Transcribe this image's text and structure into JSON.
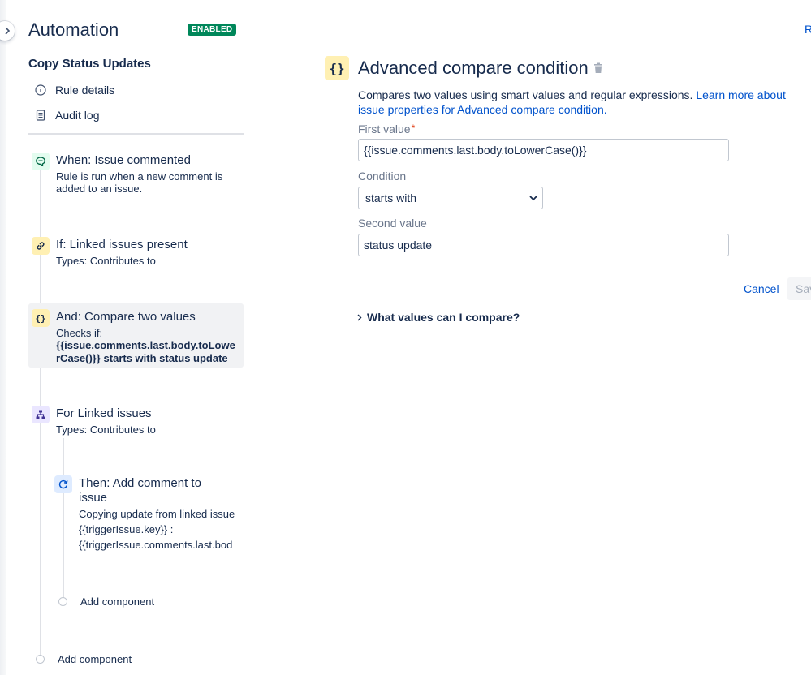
{
  "header": {
    "title": "Automation",
    "status_badge": "ENABLED",
    "top_right_link": "R"
  },
  "rule": {
    "name": "Copy Status Updates",
    "nav": [
      {
        "label": "Rule details",
        "icon": "info-icon"
      },
      {
        "label": "Audit log",
        "icon": "document-icon"
      }
    ]
  },
  "steps": {
    "trigger": {
      "title": "When: Issue commented",
      "desc_line1": "Rule is run when a new comment is",
      "desc_line2": "added to an issue.",
      "icon": "comment-icon"
    },
    "condition1": {
      "title": "If: Linked issues present",
      "desc": "Types: Contributes to",
      "icon": "link-icon"
    },
    "condition2": {
      "title": "And: Compare two values",
      "desc": "Checks if:",
      "desc_bold1": "{{issue.comments.last.body.toLowe",
      "desc_bold2": "rCase()}} starts with status update",
      "icon": "braces-icon"
    },
    "branch": {
      "title": "For Linked issues",
      "desc": "Types: Contributes to",
      "icon": "hierarchy-icon"
    },
    "action": {
      "title_line1": "Then: Add comment to",
      "title_line2": "issue",
      "desc_line1": "Copying update from linked issue",
      "desc_line2": "{{triggerIssue.key}} :",
      "desc_line3": "{{triggerIssue.comments.last.bod",
      "icon": "refresh-icon"
    },
    "add_inner": "Add component",
    "add_outer": "Add component"
  },
  "detail": {
    "icon_glyph": "{}",
    "title": "Advanced compare condition",
    "desc_text": "Compares two values using smart values and regular expressions. ",
    "desc_link": "Learn more about issue properties for Advanced compare condition.",
    "first_value_label": "First value",
    "required_mark": "*",
    "first_value": "{{issue.comments.last.body.toLowerCase()}}",
    "condition_label": "Condition",
    "condition_value": "starts with",
    "second_value_label": "Second value",
    "second_value": "status update",
    "cancel_label": "Cancel",
    "save_label": "Sav",
    "expander_label": "What values can I compare?"
  },
  "colors": {
    "badge_green": "#00875a",
    "link_blue": "#0052cc",
    "trigger_icon_bg": "#e3fcef",
    "condition_icon_bg": "#fff0b3",
    "branch_icon_bg": "#eae6ff",
    "action_icon_bg": "#deebff"
  }
}
